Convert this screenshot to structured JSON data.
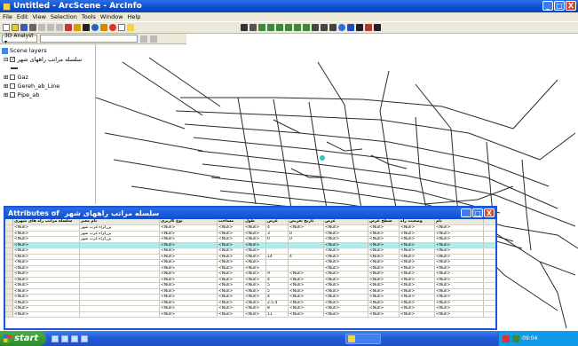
{
  "window": {
    "title": "Untitled - ArcScene - ArcInfo",
    "min": "_",
    "max": "□",
    "close": "X"
  },
  "menu": [
    "File",
    "Edit",
    "View",
    "Selection",
    "Tools",
    "Window",
    "Help"
  ],
  "toolbar2": {
    "analyst_label": "3D Analyst ▾",
    "layer_select": ""
  },
  "toc": {
    "root": "Scene layers",
    "layers": [
      {
        "label": "سلسله مراتب راههای شهر",
        "checked": true
      },
      {
        "label": "Gaz",
        "checked": false
      },
      {
        "label": "Gereh_ab_Line",
        "checked": false
      },
      {
        "label": "Pipe_ab",
        "checked": false
      }
    ]
  },
  "attributes": {
    "title_prefix": "Attributes of",
    "layer_name": "سلسله مراتب راههای شهر",
    "columns": [
      "سلسله مراتب راه های شهری",
      "نام معبر",
      "نوع کاربری",
      "مساحت",
      "طول",
      "عرض",
      "تاریخ تعریض",
      "عرض",
      "سطح عرض",
      "وضعیت راه",
      "نام"
    ],
    "rows": [
      [
        "<Null>",
        "بزرگراه غرب شهر",
        "<Null>",
        "<Null>",
        "<Null>",
        "4",
        "<Null>",
        "<Null>",
        "<Null>",
        "<Null>",
        "<Null>"
      ],
      [
        "<Null>",
        "بزرگراه غرب شهر",
        "<Null>",
        "<Null>",
        "<Null>",
        "3",
        "0",
        "<Null>",
        "<Null>",
        "<Null>",
        "<Null>"
      ],
      [
        "<Null>",
        "بزرگراه غرب شهر",
        "<Null>",
        "<Null>",
        "<Null>",
        "0",
        "0",
        "<Null>",
        "<Null>",
        "<Null>",
        "<Null>"
      ],
      [
        "<Null>",
        "",
        "<Null>",
        "<Null>",
        "<Null>",
        "",
        "",
        "<Null>",
        "<Null>",
        "<Null>",
        "<Null>"
      ],
      [
        "<Null>",
        "",
        "<Null>",
        "<Null>",
        "<Null>",
        "",
        "",
        "<Null>",
        "<Null>",
        "<Null>",
        "<Null>"
      ],
      [
        "<Null>",
        "",
        "<Null>",
        "<Null>",
        "<Null>",
        "14",
        "4",
        "<Null>",
        "<Null>",
        "<Null>",
        "<Null>"
      ],
      [
        "<Null>",
        "",
        "<Null>",
        "<Null>",
        "<Null>",
        "",
        "",
        "<Null>",
        "<Null>",
        "<Null>",
        "<Null>"
      ],
      [
        "<Null>",
        "",
        "<Null>",
        "<Null>",
        "<Null>",
        "",
        "",
        "<Null>",
        "<Null>",
        "<Null>",
        "<Null>"
      ],
      [
        "<Null>",
        "",
        "<Null>",
        "<Null>",
        "<Null>",
        "9",
        "<Null>",
        "<Null>",
        "<Null>",
        "<Null>",
        "<Null>"
      ],
      [
        "<Null>",
        "",
        "<Null>",
        "<Null>",
        "<Null>",
        "4",
        "<Null>",
        "<Null>",
        "<Null>",
        "<Null>",
        "<Null>"
      ],
      [
        "<Null>",
        "",
        "<Null>",
        "<Null>",
        "<Null>",
        "5",
        "<Null>",
        "<Null>",
        "<Null>",
        "<Null>",
        "<Null>"
      ],
      [
        "<Null>",
        "",
        "<Null>",
        "<Null>",
        "<Null>",
        "5",
        "<Null>",
        "<Null>",
        "<Null>",
        "<Null>",
        "<Null>"
      ],
      [
        "<Null>",
        "",
        "<Null>",
        "<Null>",
        "<Null>",
        "4",
        "<Null>",
        "<Null>",
        "<Null>",
        "<Null>",
        "<Null>"
      ],
      [
        "<Null>",
        "",
        "<Null>",
        "<Null>",
        "<Null>",
        "2.5.4",
        "<Null>",
        "<Null>",
        "<Null>",
        "<Null>",
        "<Null>"
      ],
      [
        "<Null>",
        "",
        "<Null>",
        "<Null>",
        "<Null>",
        "8",
        "<Null>",
        "<Null>",
        "<Null>",
        "<Null>",
        "<Null>"
      ],
      [
        "<Null>",
        "",
        "<Null>",
        "<Null>",
        "<Null>",
        "11",
        "<Null>",
        "<Null>",
        "<Null>",
        "<Null>",
        "<Null>"
      ]
    ],
    "selected_row": 3
  },
  "taskbar": {
    "start": "start",
    "tray_time": "09:04"
  },
  "colors": {
    "titlebar": "#0b4fd0",
    "selected_row": "#aeeeee",
    "start": "#2e8b2c"
  }
}
